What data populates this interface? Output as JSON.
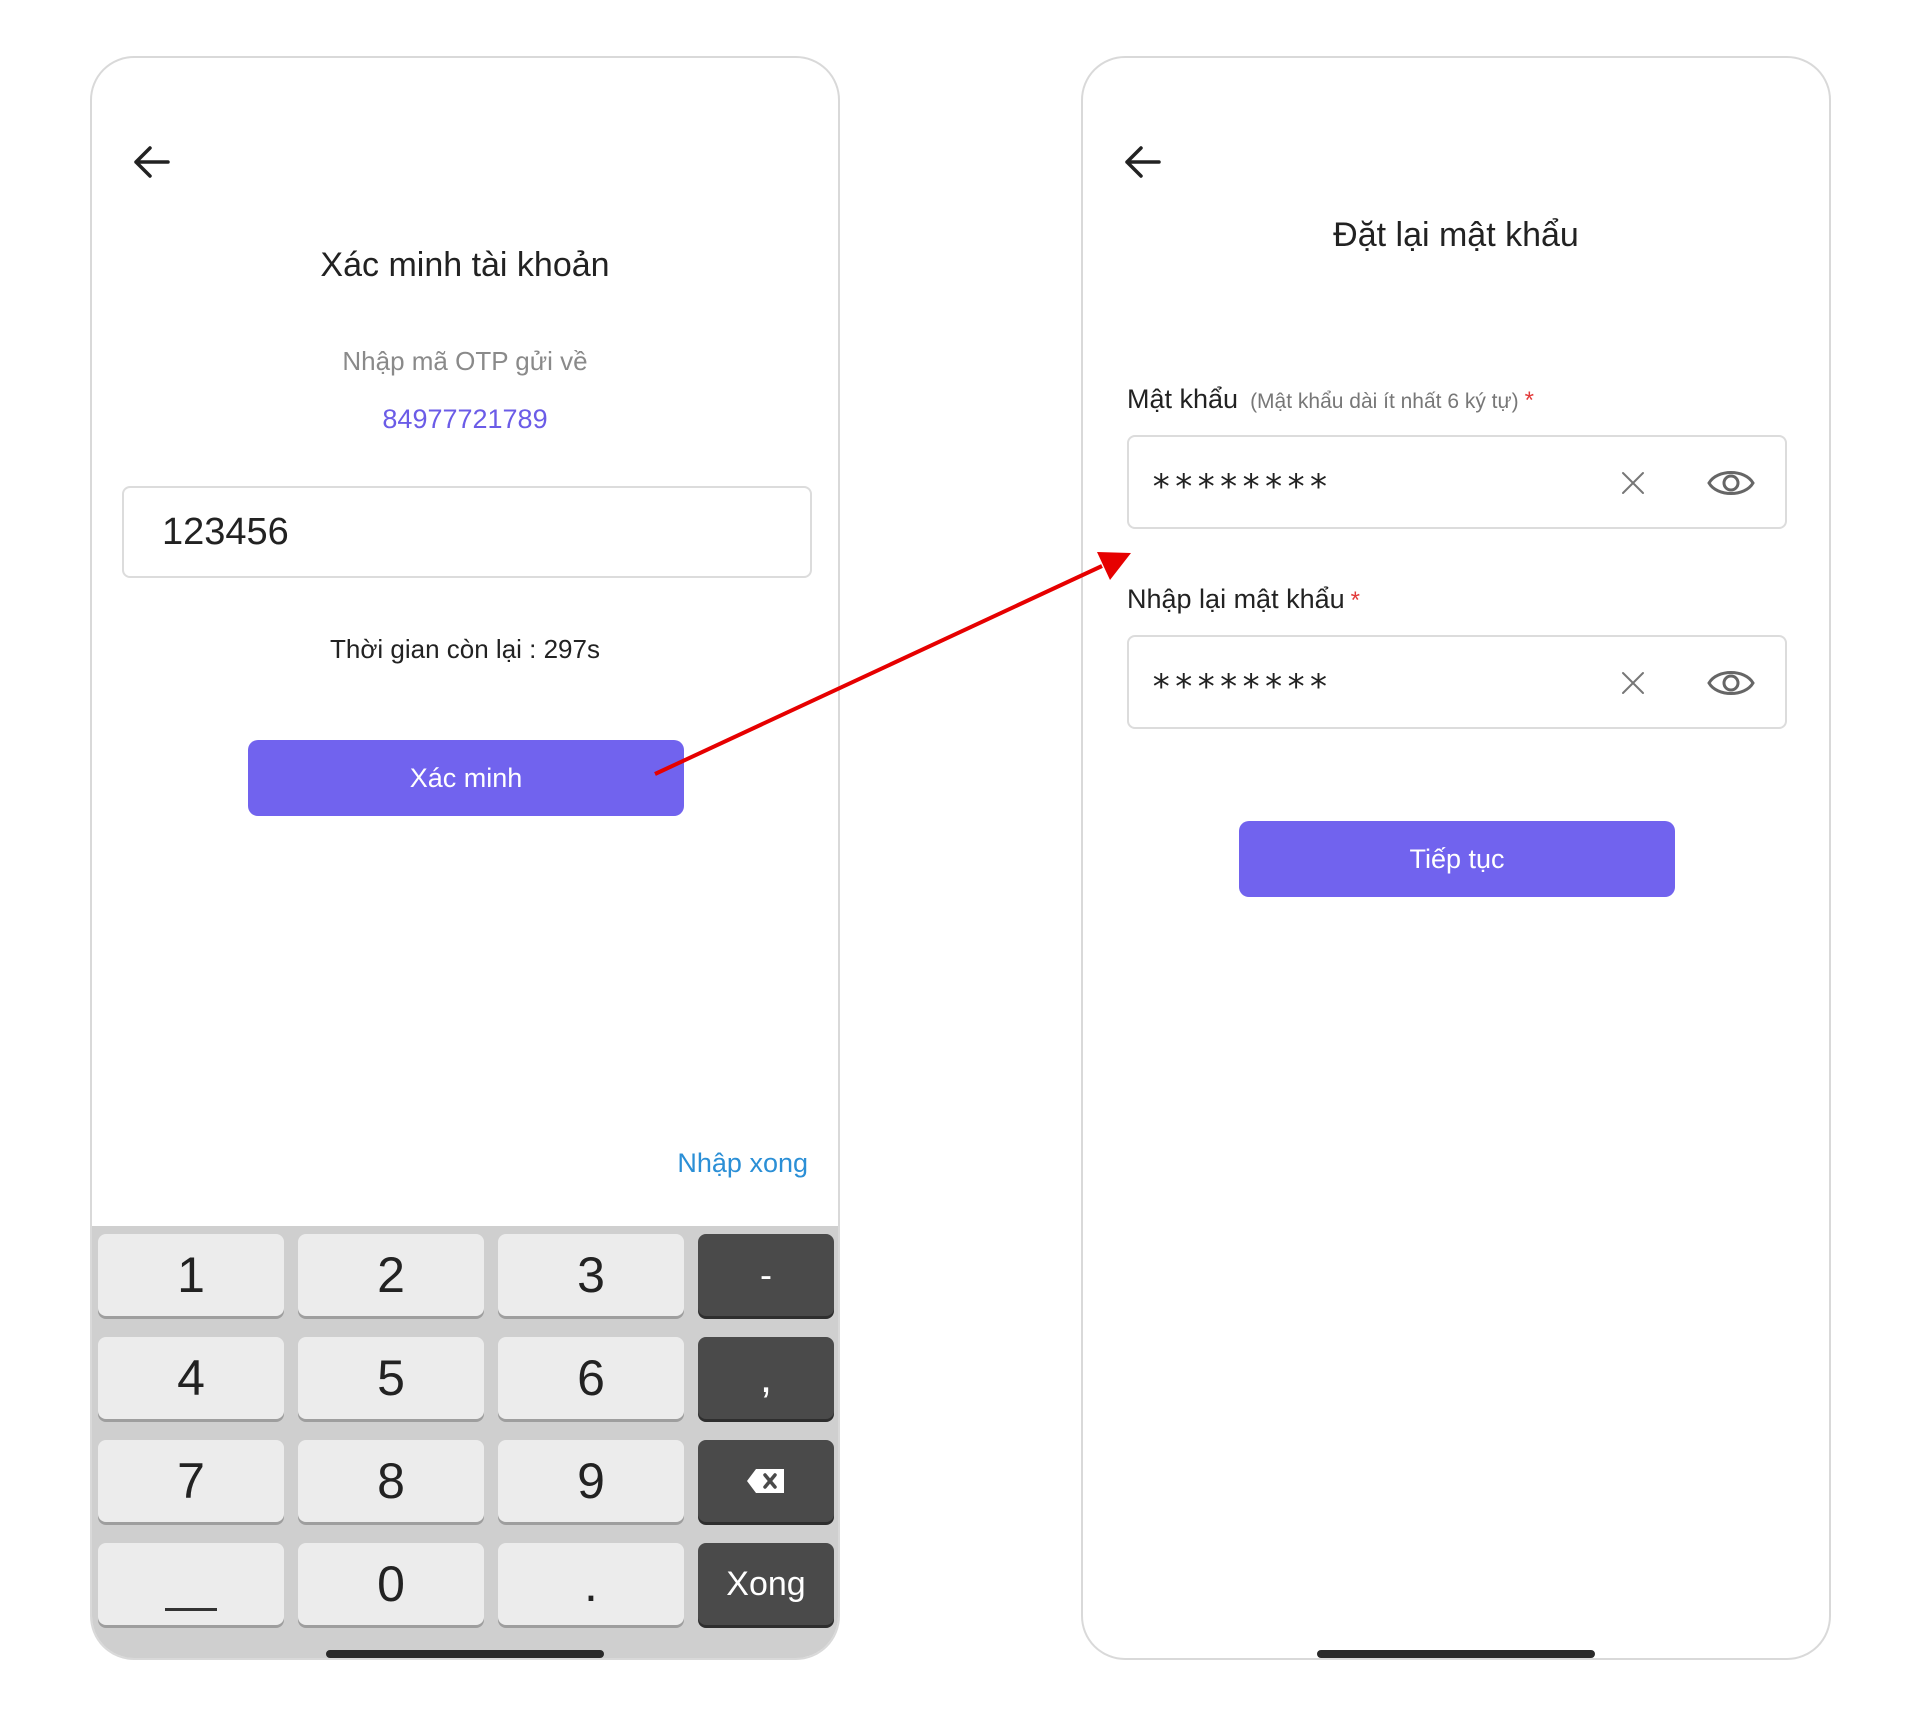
{
  "left_screen": {
    "title": "Xác minh tài khoản",
    "subtitle": "Nhập mã OTP gửi về",
    "phone_number": "84977721789",
    "otp_value": "123456",
    "timer_text": "Thời gian còn lại : 297s",
    "verify_label": "Xác minh",
    "done_link": "Nhập xong",
    "keyboard": {
      "keys": [
        "1",
        "2",
        "3",
        "-",
        "4",
        "5",
        "6",
        ",",
        "7",
        "8",
        "9",
        "0",
        "."
      ],
      "done_label": "Xong",
      "backspace_icon": "backspace-icon"
    }
  },
  "right_screen": {
    "title": "Đặt lại mật khẩu",
    "password_label": "Mật khẩu",
    "password_hint": "(Mật khẩu dài ít nhất 6 ký tự)",
    "required_mark": "*",
    "password_value": "********",
    "confirm_label": "Nhập lại mật khẩu",
    "confirm_value": "********",
    "continue_label": "Tiếp tục"
  },
  "colors": {
    "accent": "#7163ee",
    "link": "#2b8fd6",
    "required": "#e23b3b",
    "flow_arrow": "#e60000"
  }
}
